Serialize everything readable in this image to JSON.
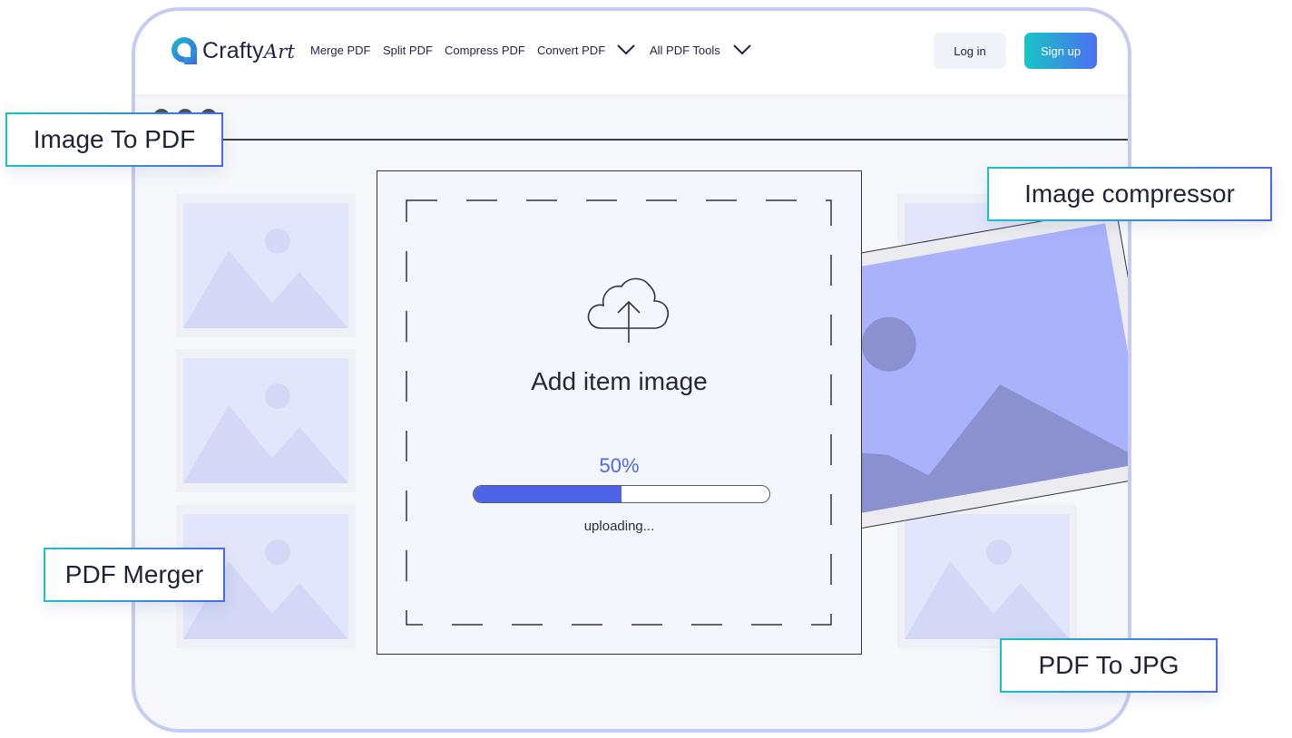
{
  "brand": {
    "name_primary": "Crafty",
    "name_script": "Art"
  },
  "nav": {
    "links": [
      "Merge PDF",
      "Split PDF",
      "Compress PDF",
      "Convert PDF",
      "All PDF Tools"
    ],
    "login_label": "Log in",
    "signup_label": "Sign up"
  },
  "upload": {
    "title": "Add item image",
    "progress_percent": 50,
    "progress_label": "50%",
    "status": "uploading..."
  },
  "tags": {
    "image_to_pdf": "Image To PDF",
    "image_compressor": "Image compressor",
    "pdf_merger": "PDF Merger",
    "pdf_to_jpg": "PDF To JPG"
  },
  "colors": {
    "accent": "#4e64e6",
    "teal": "#16c5c5",
    "frame_border": "#c5ccf4",
    "placeholder": "#e3e6fa",
    "photo_bg": "#aab2fb",
    "photo_mountain": "#8b90cf"
  }
}
